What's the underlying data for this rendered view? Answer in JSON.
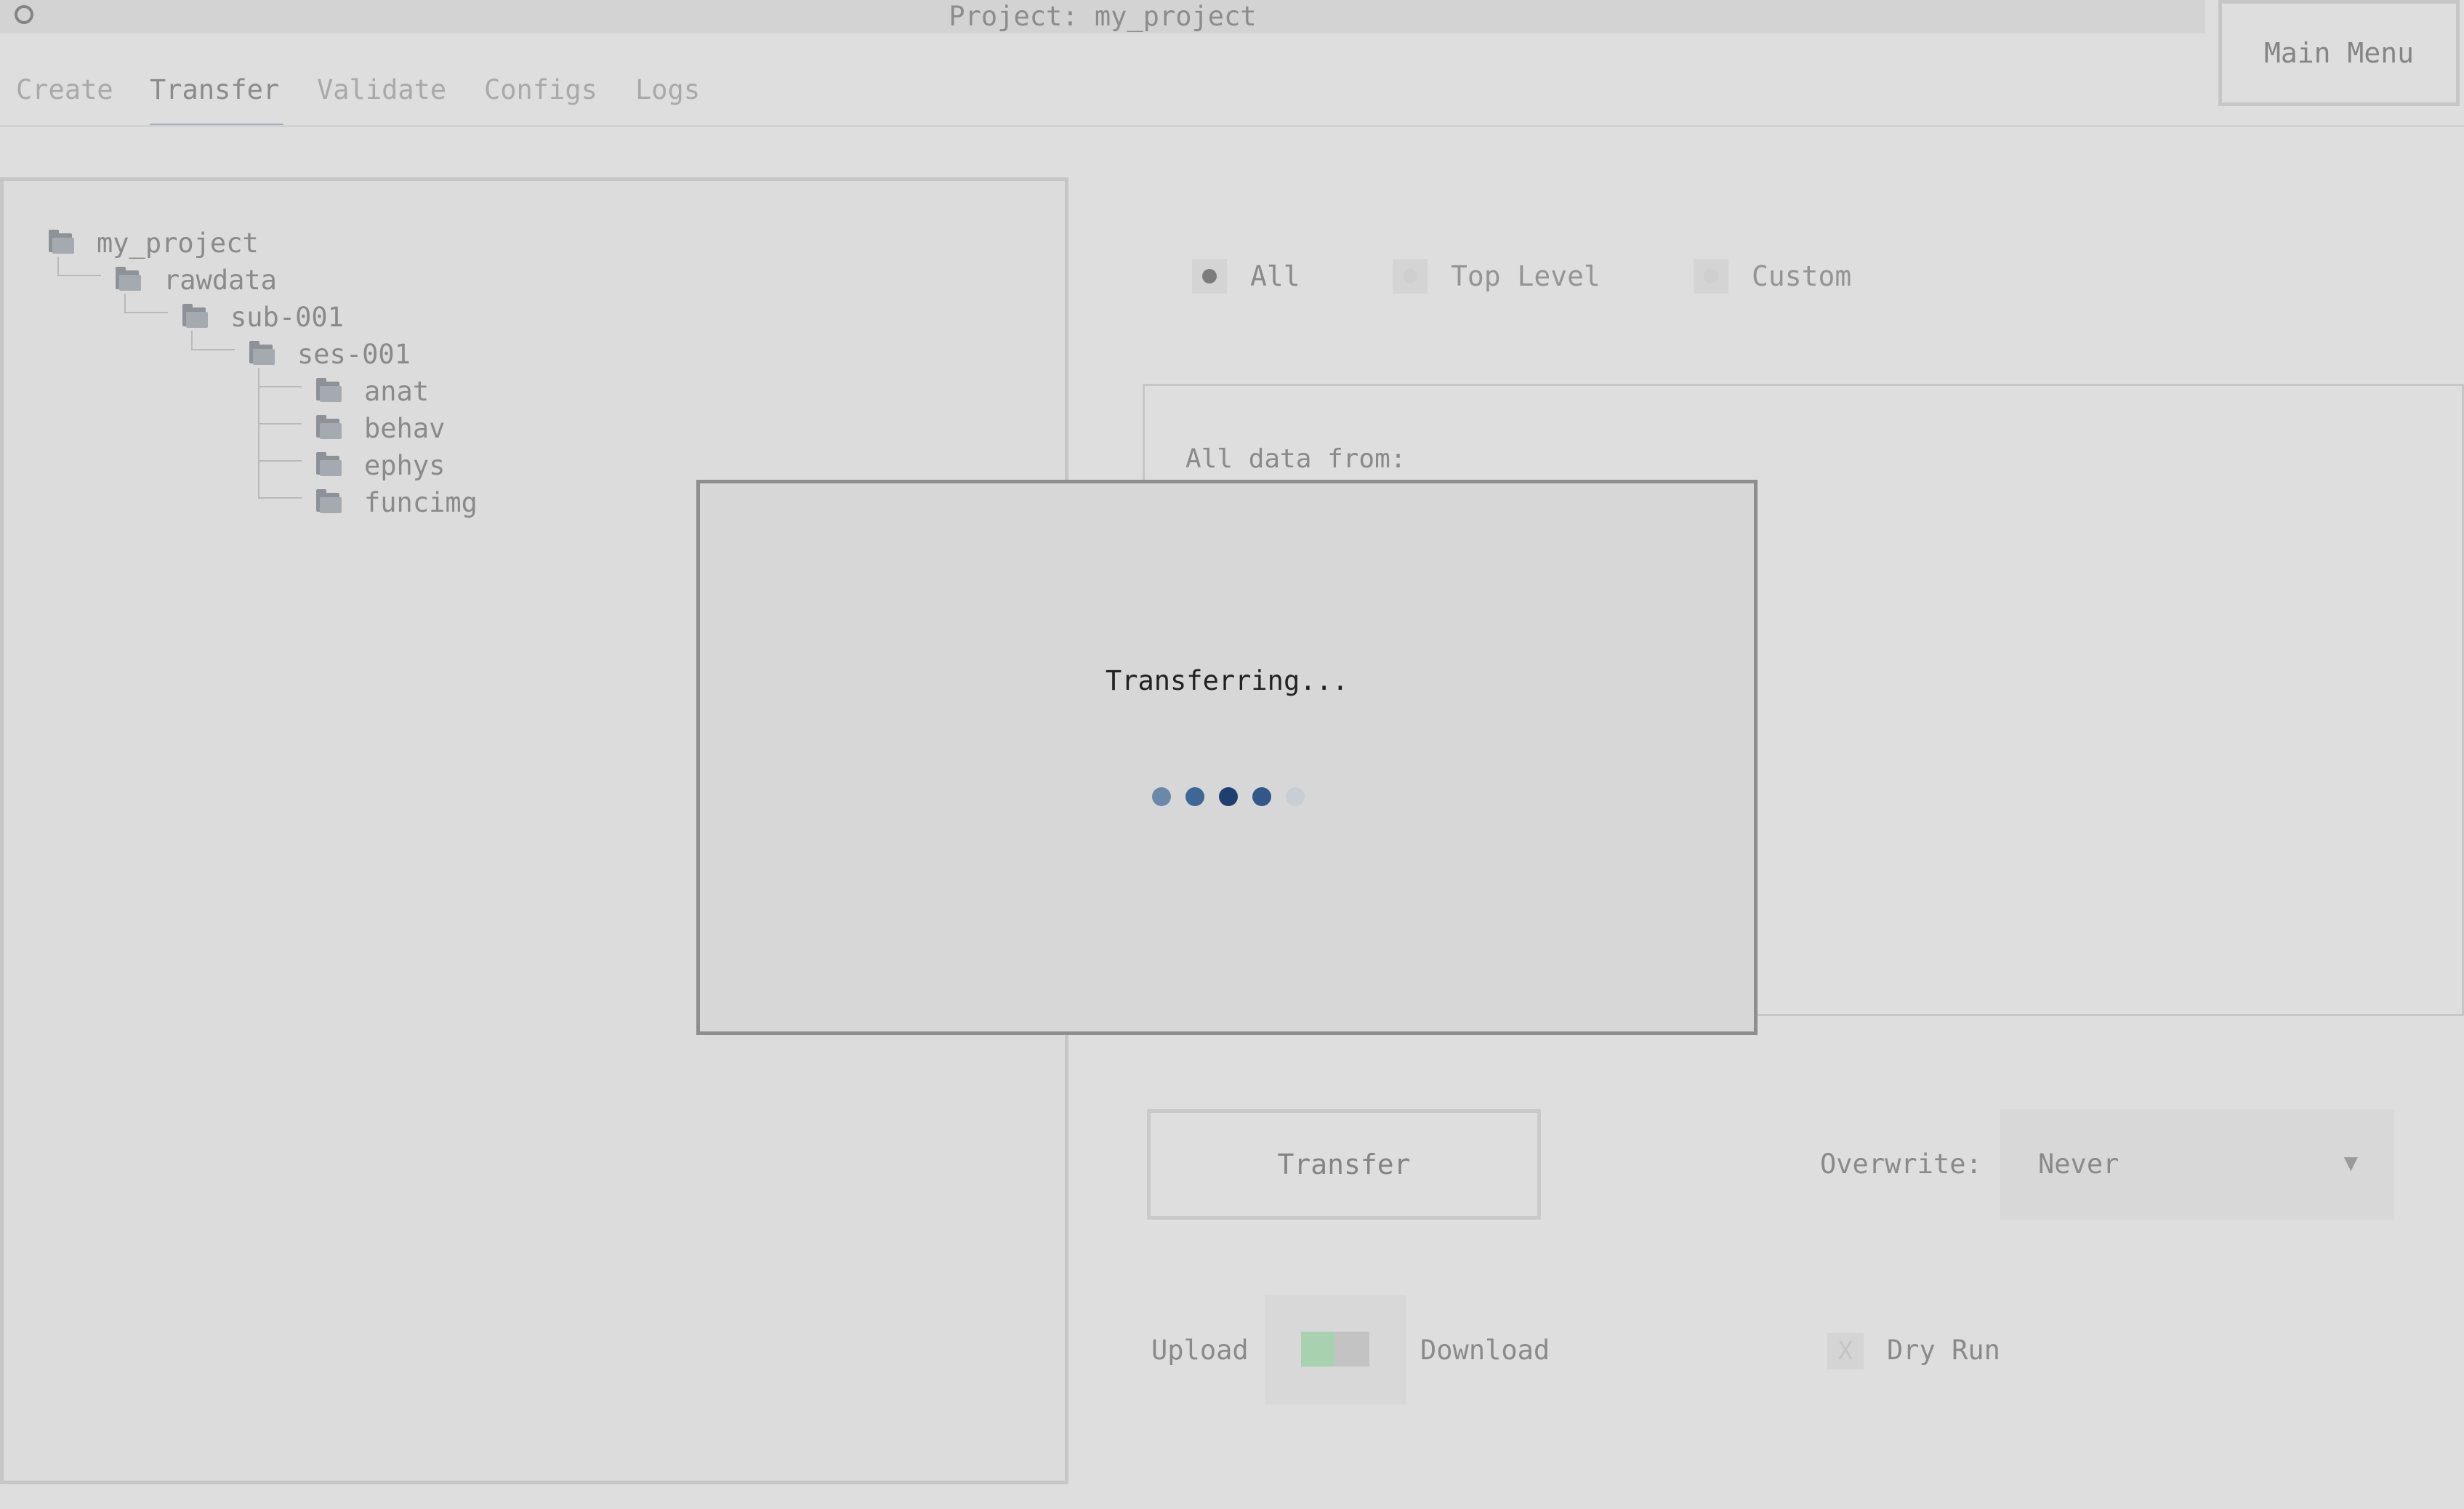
{
  "window": {
    "title": "Project: my_project",
    "main_menu_label": "Main Menu"
  },
  "tabs": [
    {
      "label": "Create",
      "active": false
    },
    {
      "label": "Transfer",
      "active": true
    },
    {
      "label": "Validate",
      "active": false
    },
    {
      "label": "Configs",
      "active": false
    },
    {
      "label": "Logs",
      "active": false
    }
  ],
  "tree": {
    "nodes": [
      {
        "name": "my_project",
        "depth": 0
      },
      {
        "name": "rawdata",
        "depth": 1
      },
      {
        "name": "sub-001",
        "depth": 2
      },
      {
        "name": "ses-001",
        "depth": 3
      },
      {
        "name": "anat",
        "depth": 4
      },
      {
        "name": "behav",
        "depth": 4
      },
      {
        "name": "ephys",
        "depth": 4
      },
      {
        "name": "funcimg",
        "depth": 4
      }
    ]
  },
  "transfer_scope": {
    "options": [
      {
        "label": "All",
        "checked": true
      },
      {
        "label": "Top Level",
        "checked": false
      },
      {
        "label": "Custom",
        "checked": false
      }
    ]
  },
  "info_box": {
    "text": "All data from:"
  },
  "actions": {
    "transfer_label": "Transfer",
    "overwrite_label": "Overwrite:",
    "overwrite_value": "Never",
    "upload_label": "Upload",
    "download_label": "Download",
    "dry_run_label": "Dry Run",
    "dry_run_mark": "X"
  },
  "modal": {
    "message": "Transferring...",
    "spinner_colors": [
      "#6a88a8",
      "#3f6796",
      "#1f3f6e",
      "#34578a",
      "#c9ced4"
    ]
  },
  "colors": {
    "accent_tab_underline": "#9fb0c4",
    "switch_on": "#a7d1af"
  }
}
